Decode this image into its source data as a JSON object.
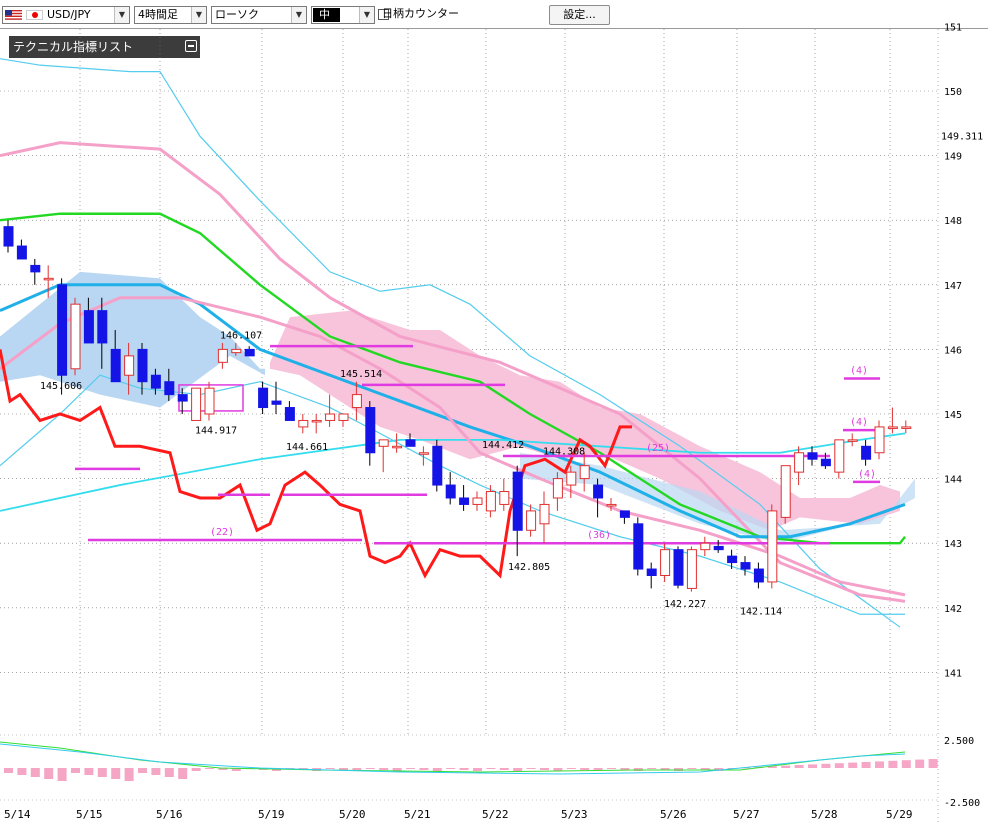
{
  "toolbar": {
    "pair": "USD/JPY",
    "timeframe": "4時間足",
    "chart_style": "ローソク",
    "size": "中",
    "counter_label": "日柄カウンター",
    "settings_label": "設定..."
  },
  "indicator_panel": {
    "title": "テクニカル指標リスト"
  },
  "colors": {
    "bull_candle": "#e03030",
    "bear_candle": "#1414e6",
    "cloud_fill_blue": "#b9d7f2",
    "cloud_fill_pink": "#f7c4dc",
    "conversion_line": "#ff1a1a",
    "ma_short": "#22d822",
    "ma_long": "#20b0e8",
    "ma_lowest": "#33ddee",
    "bollinger_outer": "#55ccee",
    "bollinger_inner": "#f4a0c8",
    "counter_line": "#e03be0",
    "grid": "#6e6e6e"
  },
  "chart_data": {
    "type": "candlestick",
    "symbol": "USD/JPY",
    "timeframe": "4時間足",
    "ylim": [
      140.6,
      151.1
    ],
    "price_ticks": [
      "151",
      "150",
      "149",
      "148",
      "147",
      "146",
      "145",
      "144",
      "143",
      "142",
      "141"
    ],
    "current_price_label": "149.311",
    "dates": [
      "5/14",
      "5/15",
      "5/16",
      "5/19",
      "5/20",
      "5/21",
      "5/22",
      "5/23",
      "5/26",
      "5/27",
      "5/28",
      "5/29"
    ],
    "oscillator": {
      "upper_label": "2.500",
      "lower_label": "-2.500",
      "ylim": [
        -2.5,
        2.5
      ]
    },
    "candles": [
      [
        147.9,
        148.0,
        147.5,
        147.6
      ],
      [
        147.6,
        147.7,
        147.4,
        147.4
      ],
      [
        147.3,
        147.4,
        147.0,
        147.2
      ],
      [
        147.1,
        147.3,
        146.8,
        147.1
      ],
      [
        147.0,
        147.1,
        145.3,
        145.6
      ],
      [
        145.7,
        146.8,
        145.6,
        146.7
      ],
      [
        146.6,
        146.8,
        146.1,
        146.1
      ],
      [
        146.6,
        146.8,
        145.7,
        146.1
      ],
      [
        146.0,
        146.3,
        145.5,
        145.5
      ],
      [
        145.6,
        146.1,
        145.3,
        145.9
      ],
      [
        146.0,
        146.1,
        145.3,
        145.5
      ],
      [
        145.6,
        145.7,
        145.3,
        145.4
      ],
      [
        145.5,
        145.7,
        145.2,
        145.3
      ],
      [
        145.3,
        145.4,
        145.0,
        145.2
      ],
      [
        144.9,
        145.4,
        144.9,
        145.4
      ],
      [
        145.0,
        145.5,
        144.9,
        145.4
      ],
      [
        145.8,
        146.1,
        145.7,
        146.0
      ],
      [
        145.95,
        146.1,
        145.9,
        146.0
      ],
      [
        146.0,
        146.05,
        145.9,
        145.9
      ],
      [
        145.4,
        145.5,
        145.0,
        145.1
      ],
      [
        145.2,
        145.5,
        145.0,
        145.15
      ],
      [
        145.1,
        145.2,
        144.9,
        144.9
      ],
      [
        144.8,
        145.0,
        144.7,
        144.9
      ],
      [
        144.9,
        145.0,
        144.7,
        144.9
      ],
      [
        144.9,
        145.3,
        144.8,
        145.0
      ],
      [
        144.9,
        145.0,
        144.8,
        145.0
      ],
      [
        145.1,
        145.5,
        144.9,
        145.3
      ],
      [
        145.1,
        145.2,
        144.2,
        144.4
      ],
      [
        144.5,
        144.6,
        144.1,
        144.6
      ],
      [
        144.5,
        144.7,
        144.4,
        144.5
      ],
      [
        144.6,
        144.7,
        144.5,
        144.5
      ],
      [
        144.4,
        144.5,
        144.2,
        144.4
      ],
      [
        144.5,
        144.6,
        143.8,
        143.9
      ],
      [
        143.9,
        144.1,
        143.6,
        143.7
      ],
      [
        143.7,
        143.9,
        143.5,
        143.6
      ],
      [
        143.6,
        143.8,
        143.5,
        143.7
      ],
      [
        143.5,
        143.9,
        143.4,
        143.8
      ],
      [
        143.6,
        144.0,
        143.5,
        143.8
      ],
      [
        144.1,
        144.2,
        142.8,
        143.2
      ],
      [
        143.2,
        143.6,
        143.1,
        143.5
      ],
      [
        143.3,
        143.8,
        143.0,
        143.6
      ],
      [
        143.7,
        144.1,
        143.5,
        144.0
      ],
      [
        143.9,
        144.2,
        143.7,
        144.1
      ],
      [
        144.0,
        144.4,
        143.8,
        144.2
      ],
      [
        143.9,
        144.0,
        143.4,
        143.7
      ],
      [
        143.6,
        143.7,
        143.5,
        143.6
      ],
      [
        143.5,
        143.5,
        143.3,
        143.4
      ],
      [
        143.3,
        143.4,
        142.5,
        142.6
      ],
      [
        142.6,
        142.7,
        142.3,
        142.5
      ],
      [
        142.5,
        143.0,
        142.4,
        142.9
      ],
      [
        142.9,
        142.95,
        142.3,
        142.35
      ],
      [
        142.3,
        142.95,
        142.25,
        142.9
      ],
      [
        142.9,
        143.1,
        142.8,
        143.0
      ],
      [
        142.95,
        143.05,
        142.85,
        142.9
      ],
      [
        142.8,
        142.9,
        142.6,
        142.7
      ],
      [
        142.7,
        142.8,
        142.5,
        142.6
      ],
      [
        142.6,
        142.7,
        142.3,
        142.4
      ],
      [
        142.4,
        143.6,
        142.3,
        143.5
      ],
      [
        143.4,
        144.2,
        143.3,
        144.2
      ],
      [
        144.1,
        144.5,
        143.9,
        144.4
      ],
      [
        144.4,
        144.5,
        144.2,
        144.3
      ],
      [
        144.3,
        144.4,
        144.15,
        144.2
      ],
      [
        144.1,
        144.6,
        144.0,
        144.6
      ],
      [
        144.6,
        144.7,
        144.5,
        144.6
      ],
      [
        144.5,
        144.6,
        144.2,
        144.3
      ],
      [
        144.4,
        144.9,
        144.3,
        144.8
      ],
      [
        144.8,
        145.1,
        144.7,
        144.8
      ],
      [
        144.8,
        144.9,
        144.7,
        144.8
      ]
    ],
    "annotations": [
      {
        "label": "145.606",
        "price": 145.606
      },
      {
        "label": "144.917",
        "price": 144.917
      },
      {
        "label": "146.107",
        "price": 146.107
      },
      {
        "label": "144.661",
        "price": 144.661
      },
      {
        "label": "145.514",
        "price": 145.514
      },
      {
        "label": "144.412",
        "price": 144.412
      },
      {
        "label": "144.308",
        "price": 144.308
      },
      {
        "label": "142.805",
        "price": 142.805
      },
      {
        "label": "142.227",
        "price": 142.227
      },
      {
        "label": "142.114",
        "price": 142.114
      }
    ],
    "counter_lines": [
      {
        "price": 144.15,
        "label": ""
      },
      {
        "price": 143.05,
        "label": "(22)"
      },
      {
        "price": 143.75,
        "label": ""
      },
      {
        "price": 143.75,
        "label": ""
      },
      {
        "price": 146.05,
        "label": ""
      },
      {
        "price": 145.45,
        "label": ""
      },
      {
        "price": 143.0,
        "label": "(36)"
      },
      {
        "price": 144.35,
        "label": "(25)"
      },
      {
        "price": 145.55,
        "label": "(4)"
      },
      {
        "price": 144.75,
        "label": "(4)"
      },
      {
        "price": 143.95,
        "label": "(4)"
      }
    ]
  }
}
